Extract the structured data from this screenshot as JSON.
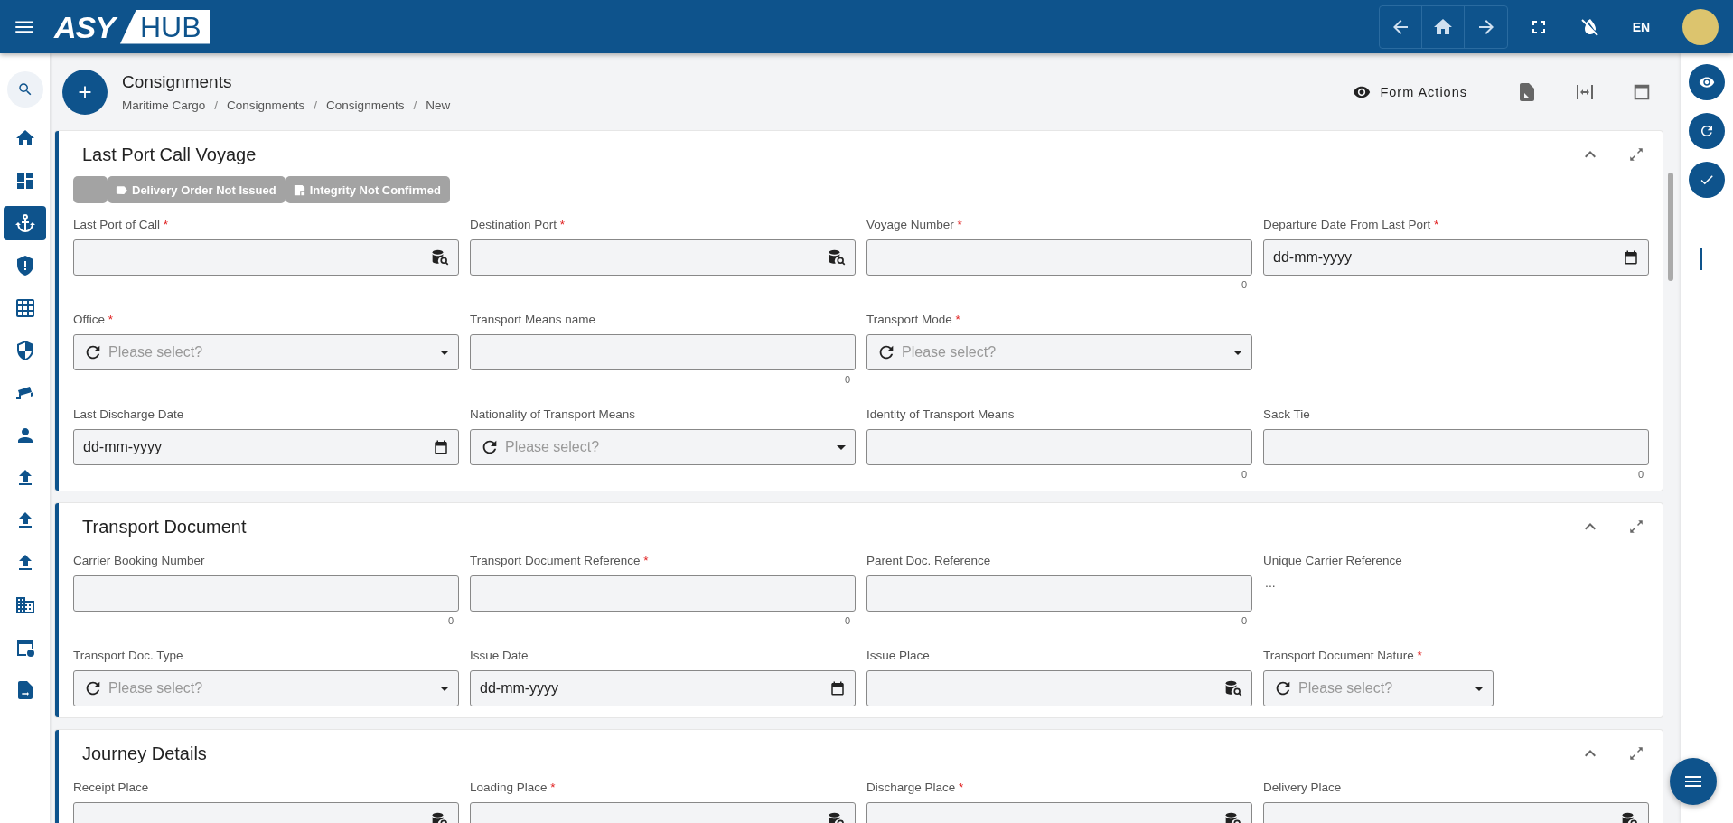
{
  "top_bar": {
    "logo": {
      "left": "ASY",
      "right": "HUB"
    },
    "nav_buttons": [
      {
        "kind": "back"
      },
      {
        "kind": "home"
      },
      {
        "kind": "forward"
      }
    ],
    "language": "EN"
  },
  "sidebar": {
    "items": [
      {
        "kind": "search",
        "selected": false
      },
      {
        "kind": "home",
        "selected": false
      },
      {
        "kind": "dashboard",
        "selected": false
      },
      {
        "kind": "anchor",
        "selected": true
      },
      {
        "kind": "alert",
        "selected": false
      },
      {
        "kind": "grid",
        "selected": false
      },
      {
        "kind": "security",
        "selected": false
      },
      {
        "kind": "camera",
        "selected": false
      },
      {
        "kind": "person",
        "selected": false
      },
      {
        "kind": "upload",
        "selected": false
      },
      {
        "kind": "upload",
        "selected": false
      },
      {
        "kind": "upload",
        "selected": false
      },
      {
        "kind": "building",
        "selected": false
      },
      {
        "kind": "settings",
        "selected": false
      },
      {
        "kind": "file",
        "selected": false
      }
    ]
  },
  "header": {
    "title": "Consignments",
    "breadcrumbs": [
      {
        "label": "Maritime Cargo"
      },
      {
        "separator": "/",
        "label": "Consignments"
      },
      {
        "separator": "/",
        "label": "Consignments"
      },
      {
        "separator": "/",
        "label": "New"
      }
    ],
    "form_actions": "Form Actions"
  },
  "sections": [
    {
      "title": "Last Port Call Voyage",
      "badges": [
        {
          "kind": "blank"
        },
        {
          "kind": "tag",
          "label": "Delivery Order Not Issued"
        },
        {
          "kind": "doc",
          "label": "Integrity Not Confirmed"
        }
      ],
      "rows": [
        [
          {
            "label": "Last Port of Call",
            "required_mark": "*",
            "kind": "lookup"
          },
          {
            "label": "Destination Port",
            "required_mark": "*",
            "kind": "lookup"
          },
          {
            "label": "Voyage Number",
            "required_mark": "*",
            "kind": "text",
            "counter": "0"
          },
          {
            "label": "Departure Date From Last Port",
            "required_mark": "*",
            "kind": "date",
            "placeholder": "dd-mm-yyyy"
          }
        ],
        [
          {
            "label": "Office",
            "required_mark": "*",
            "kind": "select",
            "placeholder": "Please select?"
          },
          {
            "label": "Transport Means name",
            "kind": "text",
            "counter": "0"
          },
          {
            "label": "Transport Mode",
            "required_mark": "*",
            "kind": "select",
            "placeholder": "Please select?"
          }
        ],
        [
          {
            "label": "Last Discharge Date",
            "kind": "date",
            "placeholder": "dd-mm-yyyy"
          },
          {
            "label": "Nationality of Transport Means",
            "kind": "select",
            "placeholder": "Please select?"
          },
          {
            "label": "Identity of Transport Means",
            "kind": "text",
            "counter": "0"
          },
          {
            "label": "Sack Tie",
            "kind": "text",
            "counter": "0"
          }
        ]
      ]
    },
    {
      "title": "Transport Document",
      "rows": [
        [
          {
            "label": "Carrier Booking Number",
            "kind": "text",
            "counter": "0"
          },
          {
            "label": "Transport Document Reference",
            "required_mark": "*",
            "kind": "text",
            "counter": "0"
          },
          {
            "label": "Parent Doc. Reference",
            "kind": "text",
            "counter": "0"
          },
          {
            "label": "Unique Carrier Reference",
            "kind": "readonly",
            "value": "..."
          }
        ],
        [
          {
            "label": "Transport Doc. Type",
            "kind": "select",
            "placeholder": "Please select?"
          },
          {
            "label": "Issue Date",
            "kind": "date",
            "placeholder": "dd-mm-yyyy"
          },
          {
            "label": "Issue Place",
            "kind": "lookup"
          },
          {
            "label": "Transport Document Nature",
            "required_mark": "*",
            "kind": "select",
            "placeholder": "Please select?",
            "narrow": true
          }
        ]
      ]
    },
    {
      "title": "Journey Details",
      "rows": [
        [
          {
            "label": "Receipt Place",
            "kind": "lookup"
          },
          {
            "label": "Loading Place",
            "required_mark": "*",
            "kind": "lookup"
          },
          {
            "label": "Discharge Place",
            "required_mark": "*",
            "kind": "lookup"
          },
          {
            "label": "Delivery Place",
            "kind": "lookup"
          }
        ]
      ]
    }
  ]
}
